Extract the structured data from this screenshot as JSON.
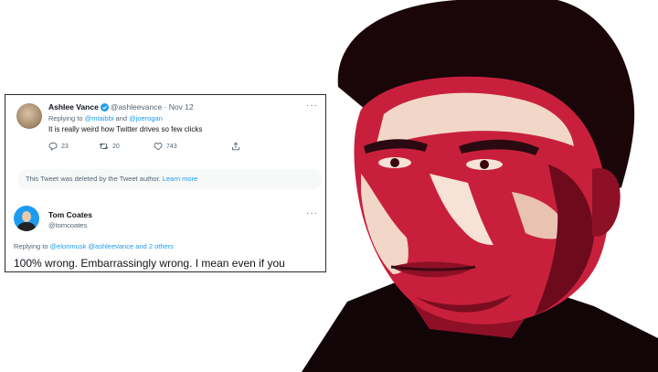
{
  "tweet1": {
    "name": "Ashlee Vance",
    "handle": "@ashleevance",
    "sep": " · ",
    "date": "Nov 12",
    "more": "···",
    "replying_prefix": "Replying to ",
    "reply_user1": "@mtaibbi",
    "reply_and": " and ",
    "reply_user2": "@joerogan",
    "text": "It is really weird how Twitter drives so few clicks",
    "reply_count": "23",
    "retweet_count": "20",
    "like_count": "743"
  },
  "deleted_notice": {
    "text": "This Tweet was deleted by the Tweet author. ",
    "link": "Learn more"
  },
  "tweet2": {
    "name": "Tom Coates",
    "handle": "@tomcoates",
    "more": "···",
    "replying_prefix": "Replying to ",
    "reply_users": "@elonmusk @ashleevance and 2 others",
    "text": "100% wrong. Embarrassingly wrong. I mean even if you"
  },
  "colors": {
    "accent": "#1d9bf0",
    "portrait_red": "#c8203c",
    "portrait_dark": "#3a0a14",
    "skin_light": "#f2d7c8"
  },
  "icons": [
    "verified-badge-icon",
    "reply-icon",
    "retweet-icon",
    "like-icon",
    "share-icon",
    "more-icon"
  ]
}
